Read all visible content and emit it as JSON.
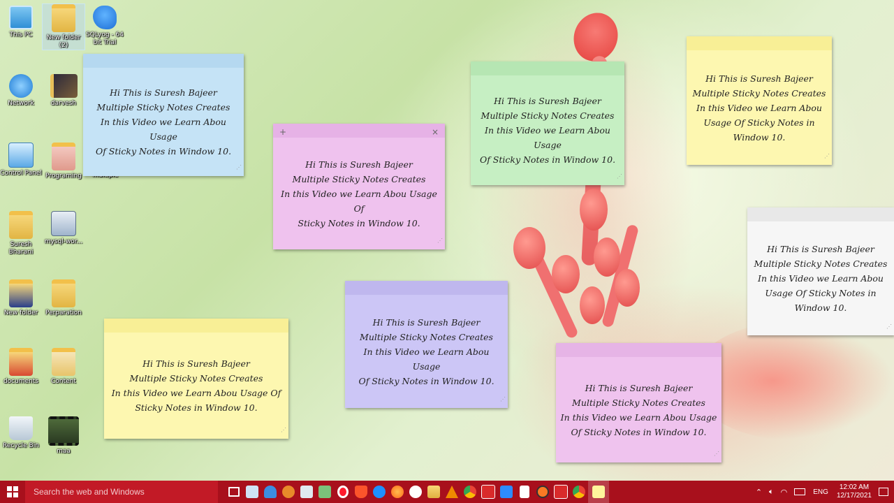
{
  "desktop_icons": [
    {
      "label": "This PC"
    },
    {
      "label": "New folder (2)"
    },
    {
      "label": "SQLyog - 64 bit Trial"
    },
    {
      "label": "Network"
    },
    {
      "label": "darvesh"
    },
    {
      "label": "Control Panel"
    },
    {
      "label": "Programing"
    },
    {
      "label": "multiple"
    },
    {
      "label": "Suresh Bharani"
    },
    {
      "label": "mysql-wor..."
    },
    {
      "label": "New folder"
    },
    {
      "label": "Perparation"
    },
    {
      "label": "documents"
    },
    {
      "label": "Content"
    },
    {
      "label": "Recycle Bin"
    },
    {
      "label": "maa"
    }
  ],
  "note_text": {
    "line1": "Hi This is Suresh Bajeer",
    "line2": "Multiple Sticky Notes Creates",
    "line3": "In this Video we Learn Abou Usage Of Sticky Notes in Window 10."
  },
  "notes": [
    {
      "color": "#c5e3f6",
      "lines": [
        "Hi This is Suresh Bajeer",
        "Multiple Sticky Notes Creates",
        "In this Video we Learn Abou Usage",
        "Of Sticky Notes in Window 10."
      ]
    },
    {
      "color": "#efc2ee",
      "lines": [
        "Hi This is Suresh Bajeer",
        "Multiple Sticky Notes Creates",
        "In this Video we Learn Abou Usage Of",
        "Sticky Notes in Window 10."
      ],
      "add": "+",
      "close": "×"
    },
    {
      "color": "#c6efc3",
      "lines": [
        "Hi This is Suresh Bajeer",
        "Multiple Sticky Notes Creates",
        "In this Video we Learn Abou Usage",
        "Of Sticky Notes in Window 10."
      ]
    },
    {
      "color": "#fdf7b0",
      "lines": [
        "Hi This is Suresh Bajeer",
        "Multiple Sticky Notes Creates",
        "In this Video we Learn Abou",
        "Usage Of Sticky Notes in",
        "Window 10."
      ]
    },
    {
      "color": "#f6f6f6",
      "lines": [
        "Hi This is Suresh Bajeer",
        "Multiple Sticky Notes Creates",
        "In this Video we Learn Abou",
        "Usage Of Sticky Notes in",
        "Window 10."
      ]
    },
    {
      "color": "#ccc6f6",
      "lines": [
        "Hi This is Suresh Bajeer",
        "Multiple Sticky Notes Creates",
        "In this Video we Learn Abou Usage",
        "Of Sticky Notes in Window 10."
      ]
    },
    {
      "color": "#fdf7b0",
      "lines": [
        "Hi This is Suresh Bajeer",
        "Multiple Sticky Notes Creates",
        "In this Video we Learn Abou Usage Of",
        "Sticky Notes in Window 10."
      ]
    },
    {
      "color": "#efc3ee",
      "lines": [
        "Hi This is Suresh Bajeer",
        "Multiple Sticky Notes Creates",
        "In this Video we Learn Abou Usage",
        "Of Sticky Notes in Window 10."
      ]
    }
  ],
  "taskbar": {
    "search_placeholder": "Search the web and Windows",
    "language": "ENG",
    "time": "12:02 AM",
    "date": "12/17/2021",
    "apps": [
      "task-view-icon",
      "remote-desktop-icon",
      "user-icon",
      "network-icon",
      "snipping-icon",
      "notepad-icon",
      "opera-icon",
      "brave-icon",
      "edge-icon",
      "firefox-icon",
      "vivaldi-icon",
      "file-explorer-icon",
      "vlc-icon",
      "chrome-icon",
      "media-icon",
      "zoom-icon",
      "document-icon",
      "xampp-icon",
      "media-icon-2",
      "chrome-icon-2",
      "sticky-notes-icon"
    ]
  }
}
